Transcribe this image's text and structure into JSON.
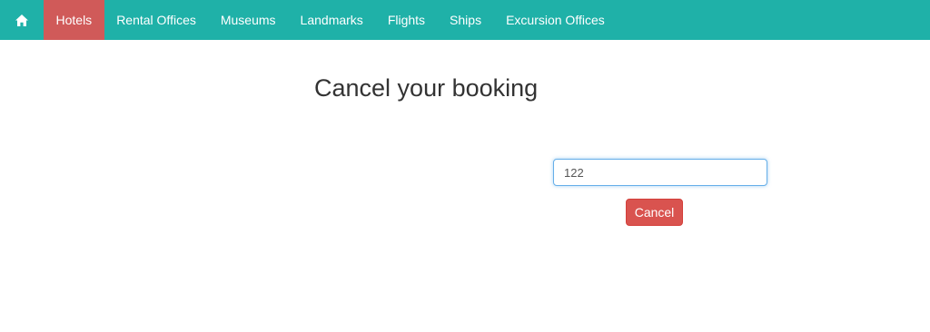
{
  "nav": {
    "home_icon": "home-icon",
    "items": [
      {
        "label": "Hotels",
        "active": true
      },
      {
        "label": "Rental Offices",
        "active": false
      },
      {
        "label": "Museums",
        "active": false
      },
      {
        "label": "Landmarks",
        "active": false
      },
      {
        "label": "Flights",
        "active": false
      },
      {
        "label": "Ships",
        "active": false
      },
      {
        "label": "Excursion Offices",
        "active": false
      }
    ]
  },
  "main": {
    "title": "Cancel your booking",
    "booking_input_value": "122",
    "cancel_label": "Cancel"
  },
  "colors": {
    "navbar": "#1fb1a8",
    "active_nav": "#d05a59",
    "danger": "#d9534f"
  }
}
